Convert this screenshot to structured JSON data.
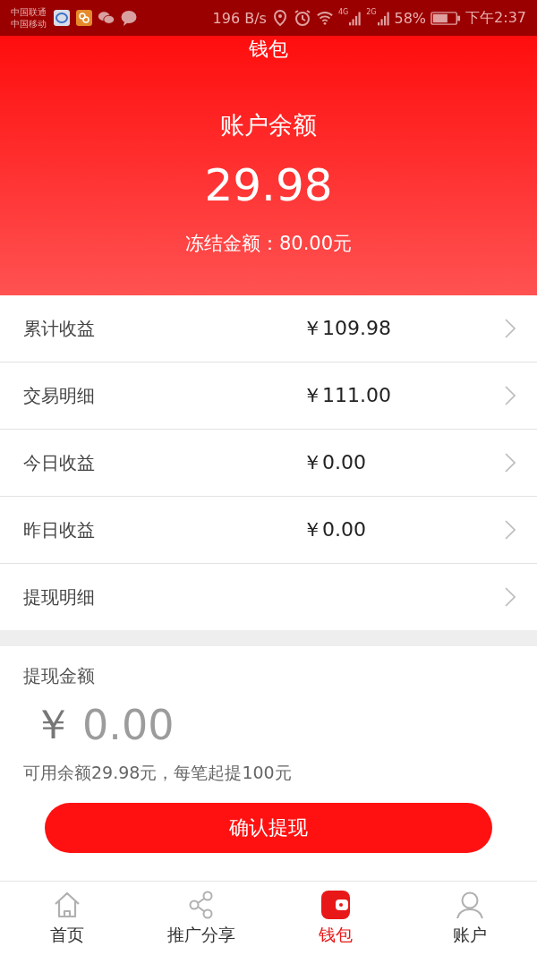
{
  "status_bar": {
    "carriers": [
      "中国联通",
      "中国移动"
    ],
    "speed": "196 B/s",
    "network_1": "4G",
    "network_2": "2G",
    "battery": "58%",
    "time": "下午2:37"
  },
  "header": {
    "title": "钱包",
    "balance_label": "账户余额",
    "balance": "29.98",
    "frozen": "冻结金额：80.00元"
  },
  "rows": [
    {
      "label": "累计收益",
      "amount": "￥109.98"
    },
    {
      "label": "交易明细",
      "amount": "￥111.00"
    },
    {
      "label": "今日收益",
      "amount": "￥0.00"
    },
    {
      "label": "昨日收益",
      "amount": "￥0.00"
    },
    {
      "label": "提现明细"
    }
  ],
  "withdraw": {
    "title": "提现金额",
    "currency": "￥",
    "placeholder": "0.00",
    "hint": "可用余额29.98元，每笔起提100元",
    "button": "确认提现"
  },
  "tabs": [
    {
      "kind": "home",
      "label": "首页",
      "selected": false
    },
    {
      "kind": "share",
      "label": "推广分享",
      "selected": false
    },
    {
      "kind": "wallet",
      "label": "钱包",
      "selected": true
    },
    {
      "kind": "account",
      "label": "账户",
      "selected": false
    }
  ]
}
